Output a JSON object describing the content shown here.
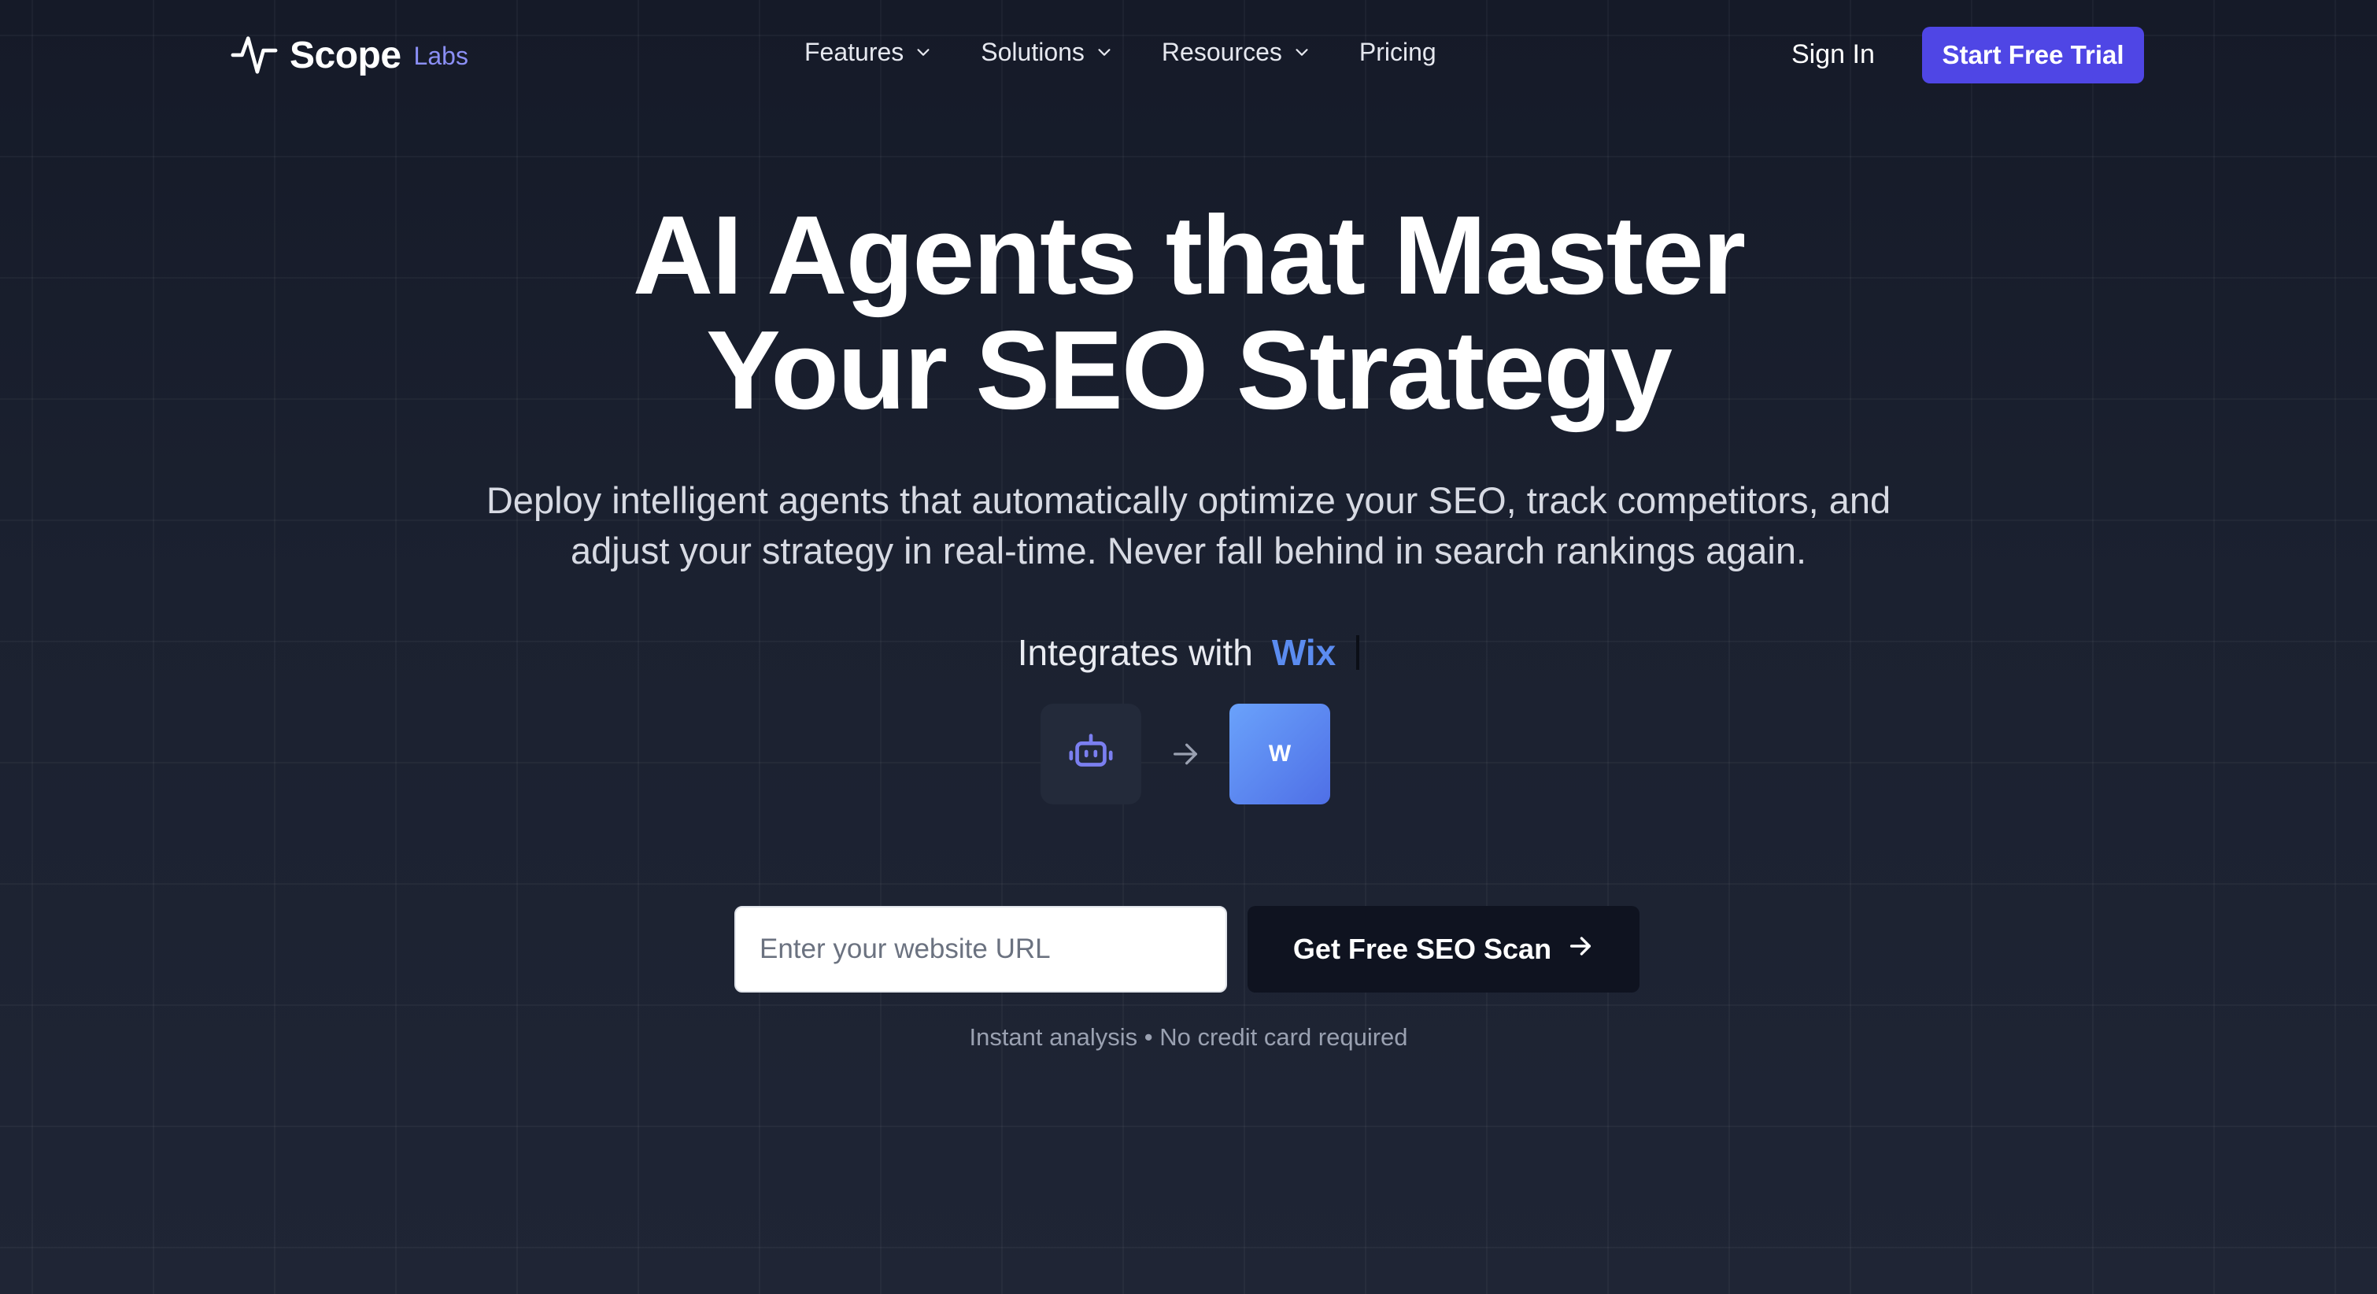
{
  "brand": {
    "name": "Scope",
    "sub": "Labs"
  },
  "nav": {
    "items": [
      {
        "label": "Features",
        "has_dropdown": true
      },
      {
        "label": "Solutions",
        "has_dropdown": true
      },
      {
        "label": "Resources",
        "has_dropdown": true
      },
      {
        "label": "Pricing",
        "has_dropdown": false
      }
    ],
    "sign_in": "Sign In",
    "cta": "Start Free Trial"
  },
  "hero": {
    "title_line1": "AI Agents that Master",
    "title_line2": "Your SEO Strategy",
    "subtitle_line1": "Deploy intelligent agents that automatically optimize your SEO, track competitors, and",
    "subtitle_line2": "adjust your strategy in real-time. Never fall behind in search rankings again."
  },
  "integrations": {
    "label": "Integrates with",
    "current": "Wix",
    "tile_letter": "W",
    "icons": [
      "bot-icon",
      "arrow-right-icon"
    ]
  },
  "scan": {
    "input_value": "",
    "input_placeholder": "Enter your website URL",
    "button_label": "Get Free SEO Scan",
    "note": "Instant analysis • No credit card required"
  },
  "colors": {
    "accent": "#4f46e5",
    "brand_sub": "#8b8ff5",
    "integration_highlight": "#5b8cf0",
    "background": "#1b2130"
  }
}
